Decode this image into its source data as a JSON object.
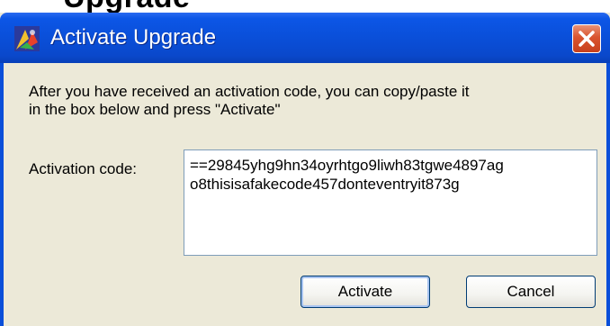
{
  "dialog": {
    "title": "Activate Upgrade",
    "message_line1": "After you have received an activation code, you can copy/paste it",
    "message_line2": "in the box below and press \"Activate\"",
    "code_label": "Activation code:",
    "code_line1": "==29845yhg9hn34oyrhtgo9liwh83tgwe4897ag",
    "code_line2": "o8thisisafakecode457donteventryit873g",
    "activate_label": "Activate",
    "cancel_label": "Cancel",
    "app_icon": "app-logo-icon",
    "close_icon": "close-icon"
  },
  "background_title": "Upgrade"
}
